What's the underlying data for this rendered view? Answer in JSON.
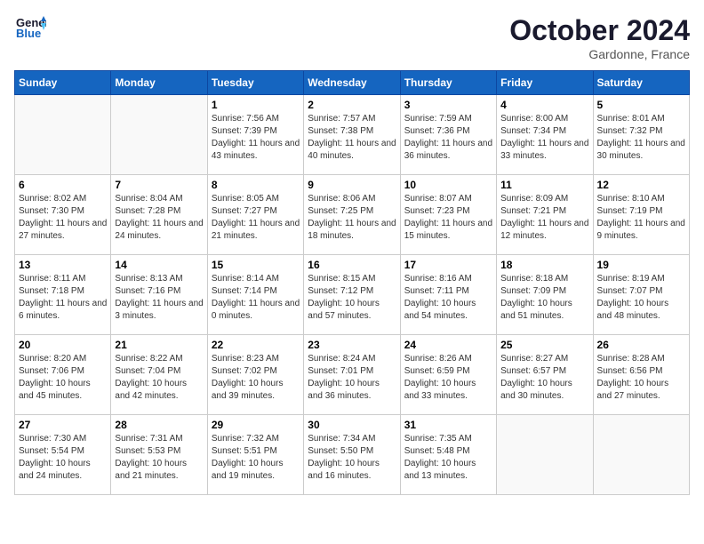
{
  "header": {
    "logo_line1": "General",
    "logo_line2": "Blue",
    "month": "October 2024",
    "location": "Gardonne, France"
  },
  "weekdays": [
    "Sunday",
    "Monday",
    "Tuesday",
    "Wednesday",
    "Thursday",
    "Friday",
    "Saturday"
  ],
  "weeks": [
    [
      {
        "day": "",
        "info": ""
      },
      {
        "day": "",
        "info": ""
      },
      {
        "day": "1",
        "info": "Sunrise: 7:56 AM\nSunset: 7:39 PM\nDaylight: 11 hours and 43 minutes."
      },
      {
        "day": "2",
        "info": "Sunrise: 7:57 AM\nSunset: 7:38 PM\nDaylight: 11 hours and 40 minutes."
      },
      {
        "day": "3",
        "info": "Sunrise: 7:59 AM\nSunset: 7:36 PM\nDaylight: 11 hours and 36 minutes."
      },
      {
        "day": "4",
        "info": "Sunrise: 8:00 AM\nSunset: 7:34 PM\nDaylight: 11 hours and 33 minutes."
      },
      {
        "day": "5",
        "info": "Sunrise: 8:01 AM\nSunset: 7:32 PM\nDaylight: 11 hours and 30 minutes."
      }
    ],
    [
      {
        "day": "6",
        "info": "Sunrise: 8:02 AM\nSunset: 7:30 PM\nDaylight: 11 hours and 27 minutes."
      },
      {
        "day": "7",
        "info": "Sunrise: 8:04 AM\nSunset: 7:28 PM\nDaylight: 11 hours and 24 minutes."
      },
      {
        "day": "8",
        "info": "Sunrise: 8:05 AM\nSunset: 7:27 PM\nDaylight: 11 hours and 21 minutes."
      },
      {
        "day": "9",
        "info": "Sunrise: 8:06 AM\nSunset: 7:25 PM\nDaylight: 11 hours and 18 minutes."
      },
      {
        "day": "10",
        "info": "Sunrise: 8:07 AM\nSunset: 7:23 PM\nDaylight: 11 hours and 15 minutes."
      },
      {
        "day": "11",
        "info": "Sunrise: 8:09 AM\nSunset: 7:21 PM\nDaylight: 11 hours and 12 minutes."
      },
      {
        "day": "12",
        "info": "Sunrise: 8:10 AM\nSunset: 7:19 PM\nDaylight: 11 hours and 9 minutes."
      }
    ],
    [
      {
        "day": "13",
        "info": "Sunrise: 8:11 AM\nSunset: 7:18 PM\nDaylight: 11 hours and 6 minutes."
      },
      {
        "day": "14",
        "info": "Sunrise: 8:13 AM\nSunset: 7:16 PM\nDaylight: 11 hours and 3 minutes."
      },
      {
        "day": "15",
        "info": "Sunrise: 8:14 AM\nSunset: 7:14 PM\nDaylight: 11 hours and 0 minutes."
      },
      {
        "day": "16",
        "info": "Sunrise: 8:15 AM\nSunset: 7:12 PM\nDaylight: 10 hours and 57 minutes."
      },
      {
        "day": "17",
        "info": "Sunrise: 8:16 AM\nSunset: 7:11 PM\nDaylight: 10 hours and 54 minutes."
      },
      {
        "day": "18",
        "info": "Sunrise: 8:18 AM\nSunset: 7:09 PM\nDaylight: 10 hours and 51 minutes."
      },
      {
        "day": "19",
        "info": "Sunrise: 8:19 AM\nSunset: 7:07 PM\nDaylight: 10 hours and 48 minutes."
      }
    ],
    [
      {
        "day": "20",
        "info": "Sunrise: 8:20 AM\nSunset: 7:06 PM\nDaylight: 10 hours and 45 minutes."
      },
      {
        "day": "21",
        "info": "Sunrise: 8:22 AM\nSunset: 7:04 PM\nDaylight: 10 hours and 42 minutes."
      },
      {
        "day": "22",
        "info": "Sunrise: 8:23 AM\nSunset: 7:02 PM\nDaylight: 10 hours and 39 minutes."
      },
      {
        "day": "23",
        "info": "Sunrise: 8:24 AM\nSunset: 7:01 PM\nDaylight: 10 hours and 36 minutes."
      },
      {
        "day": "24",
        "info": "Sunrise: 8:26 AM\nSunset: 6:59 PM\nDaylight: 10 hours and 33 minutes."
      },
      {
        "day": "25",
        "info": "Sunrise: 8:27 AM\nSunset: 6:57 PM\nDaylight: 10 hours and 30 minutes."
      },
      {
        "day": "26",
        "info": "Sunrise: 8:28 AM\nSunset: 6:56 PM\nDaylight: 10 hours and 27 minutes."
      }
    ],
    [
      {
        "day": "27",
        "info": "Sunrise: 7:30 AM\nSunset: 5:54 PM\nDaylight: 10 hours and 24 minutes."
      },
      {
        "day": "28",
        "info": "Sunrise: 7:31 AM\nSunset: 5:53 PM\nDaylight: 10 hours and 21 minutes."
      },
      {
        "day": "29",
        "info": "Sunrise: 7:32 AM\nSunset: 5:51 PM\nDaylight: 10 hours and 19 minutes."
      },
      {
        "day": "30",
        "info": "Sunrise: 7:34 AM\nSunset: 5:50 PM\nDaylight: 10 hours and 16 minutes."
      },
      {
        "day": "31",
        "info": "Sunrise: 7:35 AM\nSunset: 5:48 PM\nDaylight: 10 hours and 13 minutes."
      },
      {
        "day": "",
        "info": ""
      },
      {
        "day": "",
        "info": ""
      }
    ]
  ]
}
